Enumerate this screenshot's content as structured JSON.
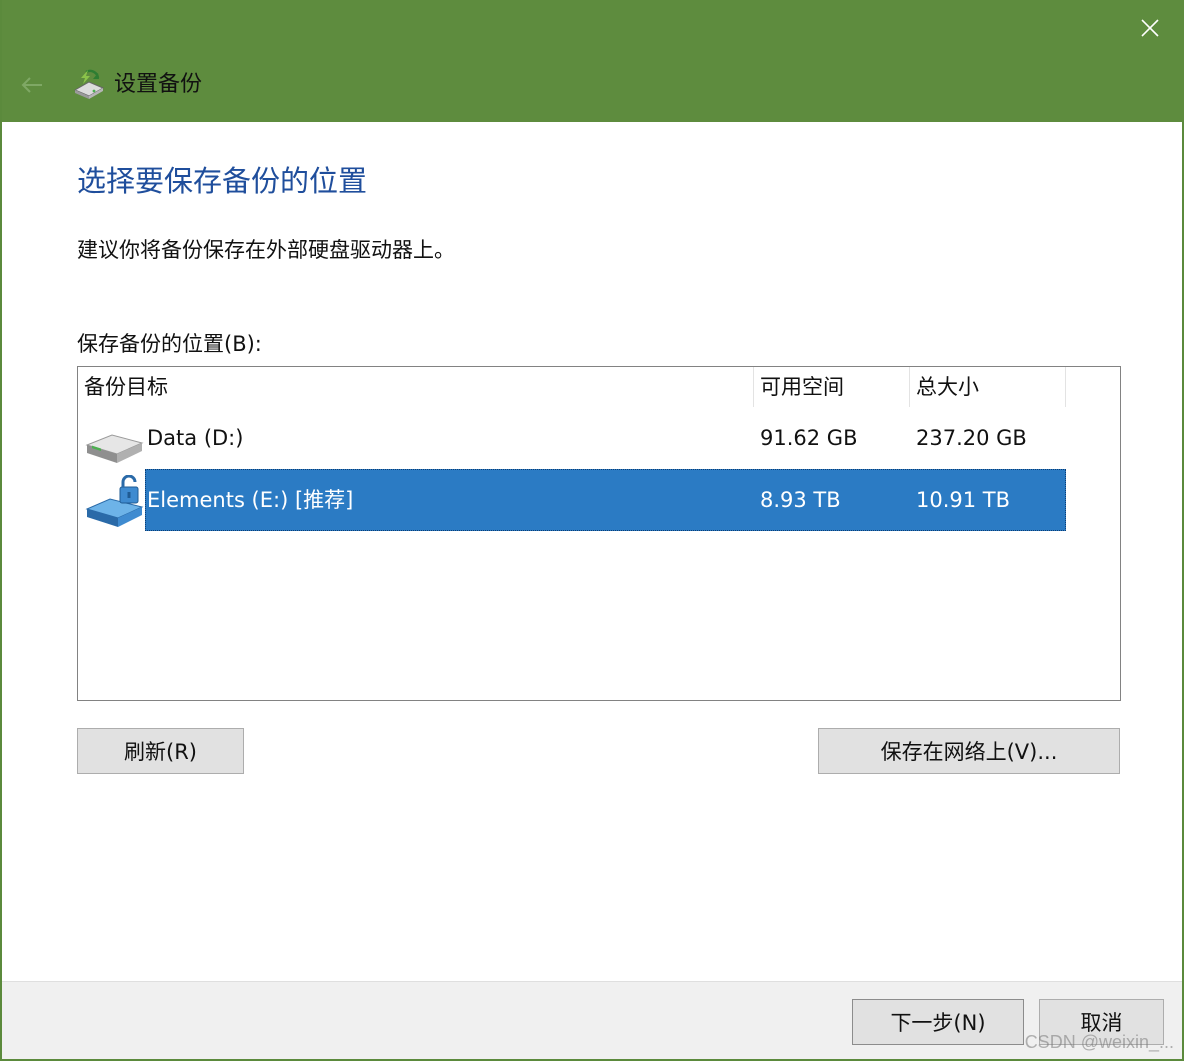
{
  "window": {
    "title": "设置备份",
    "accent_color": "#5e8c3e"
  },
  "main": {
    "heading": "选择要保存备份的位置",
    "description": "建议你将备份保存在外部硬盘驱动器上。",
    "list_label": "保存备份的位置(B):"
  },
  "table": {
    "columns": [
      "备份目标",
      "可用空间",
      "总大小"
    ],
    "rows": [
      {
        "name": "Data (D:)",
        "free": "91.62 GB",
        "total": "237.20 GB",
        "icon": "hard-drive-icon",
        "selected": false
      },
      {
        "name": "Elements (E:) [推荐]",
        "free": "8.93 TB",
        "total": "10.91 TB",
        "icon": "external-drive-icon",
        "selected": true
      }
    ],
    "selection_color": "#2b7bc4"
  },
  "buttons": {
    "refresh": "刷新(R)",
    "save_network": "保存在网络上(V)...",
    "next": "下一步(N)",
    "cancel": "取消"
  },
  "watermark": "CSDN @weixin_..."
}
